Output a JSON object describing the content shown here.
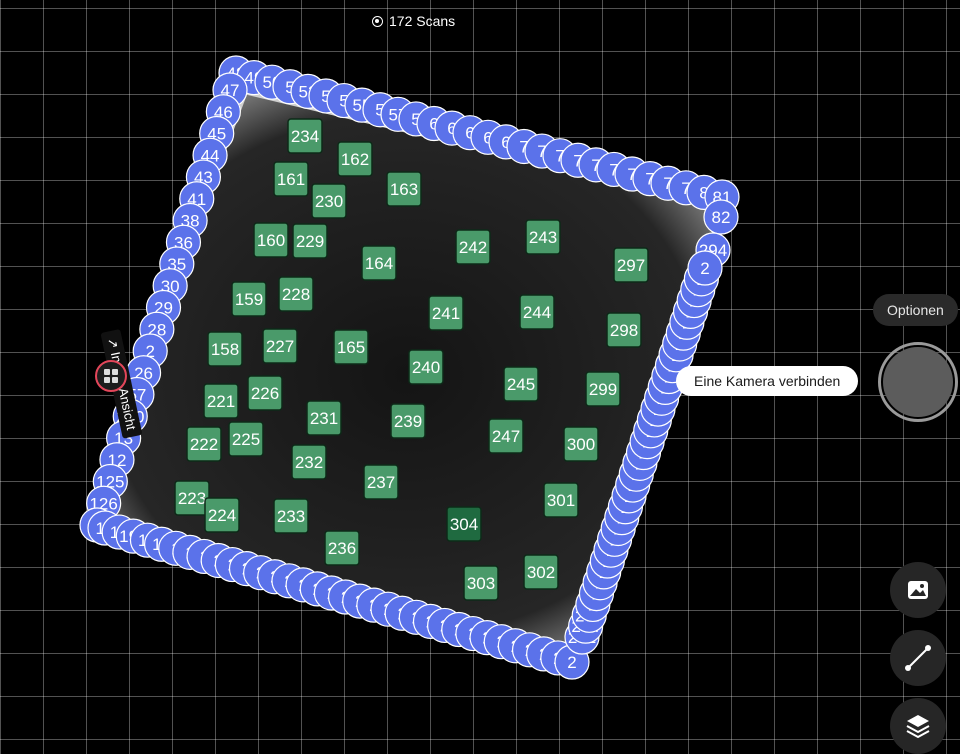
{
  "status": {
    "scan_count_text": "172 Scans"
  },
  "camera": {
    "tag_label": "↗ Innen-Ansicht"
  },
  "buttons": {
    "options_label": "Optionen",
    "connect_camera_label": "Eine Kamera verbinden"
  },
  "icons": {
    "image": "image-icon",
    "measure": "measure-line-icon",
    "layers": "layers-icon"
  },
  "colors": {
    "perimeter_scan": "#5b72ea",
    "interior_scan": "#4a9a6a",
    "selected_scan": "#1f6a40",
    "camera_pin": "#e3465a"
  },
  "perimeter_scans": {
    "top": [
      "48",
      "49",
      "50",
      "5",
      "52",
      "5",
      "5",
      "55",
      "5",
      "57",
      "5",
      "6",
      "6",
      "6",
      "6",
      "6",
      "7",
      "7",
      "7",
      "7",
      "7",
      "7",
      "7",
      "7",
      "7",
      "7",
      "8",
      "81"
    ],
    "right": [
      "82",
      "294"
    ],
    "left": [
      "47",
      "46",
      "45",
      "44",
      "43",
      "41",
      "38",
      "36",
      "35",
      "30",
      "29",
      "28",
      "2",
      "26",
      "57",
      "220",
      "13",
      "12",
      "125",
      "126",
      "18"
    ],
    "bottom": [
      "19",
      "19",
      "191",
      "19",
      "19",
      "1",
      "1",
      "1",
      "2",
      "2",
      "2",
      "2",
      "2",
      "2",
      "2",
      "2",
      "2",
      "2",
      "2",
      "2",
      "2",
      "2",
      "2",
      "2",
      "2",
      "2",
      "2",
      "2",
      "2",
      "2",
      "2",
      "2",
      "2",
      "2"
    ],
    "right_side": [
      "291",
      "204",
      "297",
      "2",
      "2",
      "2",
      "2",
      "2",
      "2",
      "2",
      "2",
      "2",
      "2",
      "2",
      "2",
      "2",
      "2",
      "2",
      "2",
      "2",
      "2",
      "2",
      "2",
      "2",
      "2",
      "2",
      "2",
      "2",
      "2",
      "2",
      "2",
      "2",
      "2",
      "2",
      "2"
    ]
  },
  "interior_scans": [
    "234",
    "162",
    "161",
    "163",
    "230",
    "160",
    "229",
    "242",
    "243",
    "164",
    "297",
    "228",
    "159",
    "241",
    "244",
    "298",
    "158",
    "227",
    "165",
    "240",
    "245",
    "299",
    "221",
    "226",
    "231",
    "239",
    "247",
    "300",
    "222",
    "225",
    "232",
    "237",
    "301",
    "223",
    "224",
    "233",
    "304",
    "236",
    "303",
    "302"
  ],
  "selected_scan": "304"
}
